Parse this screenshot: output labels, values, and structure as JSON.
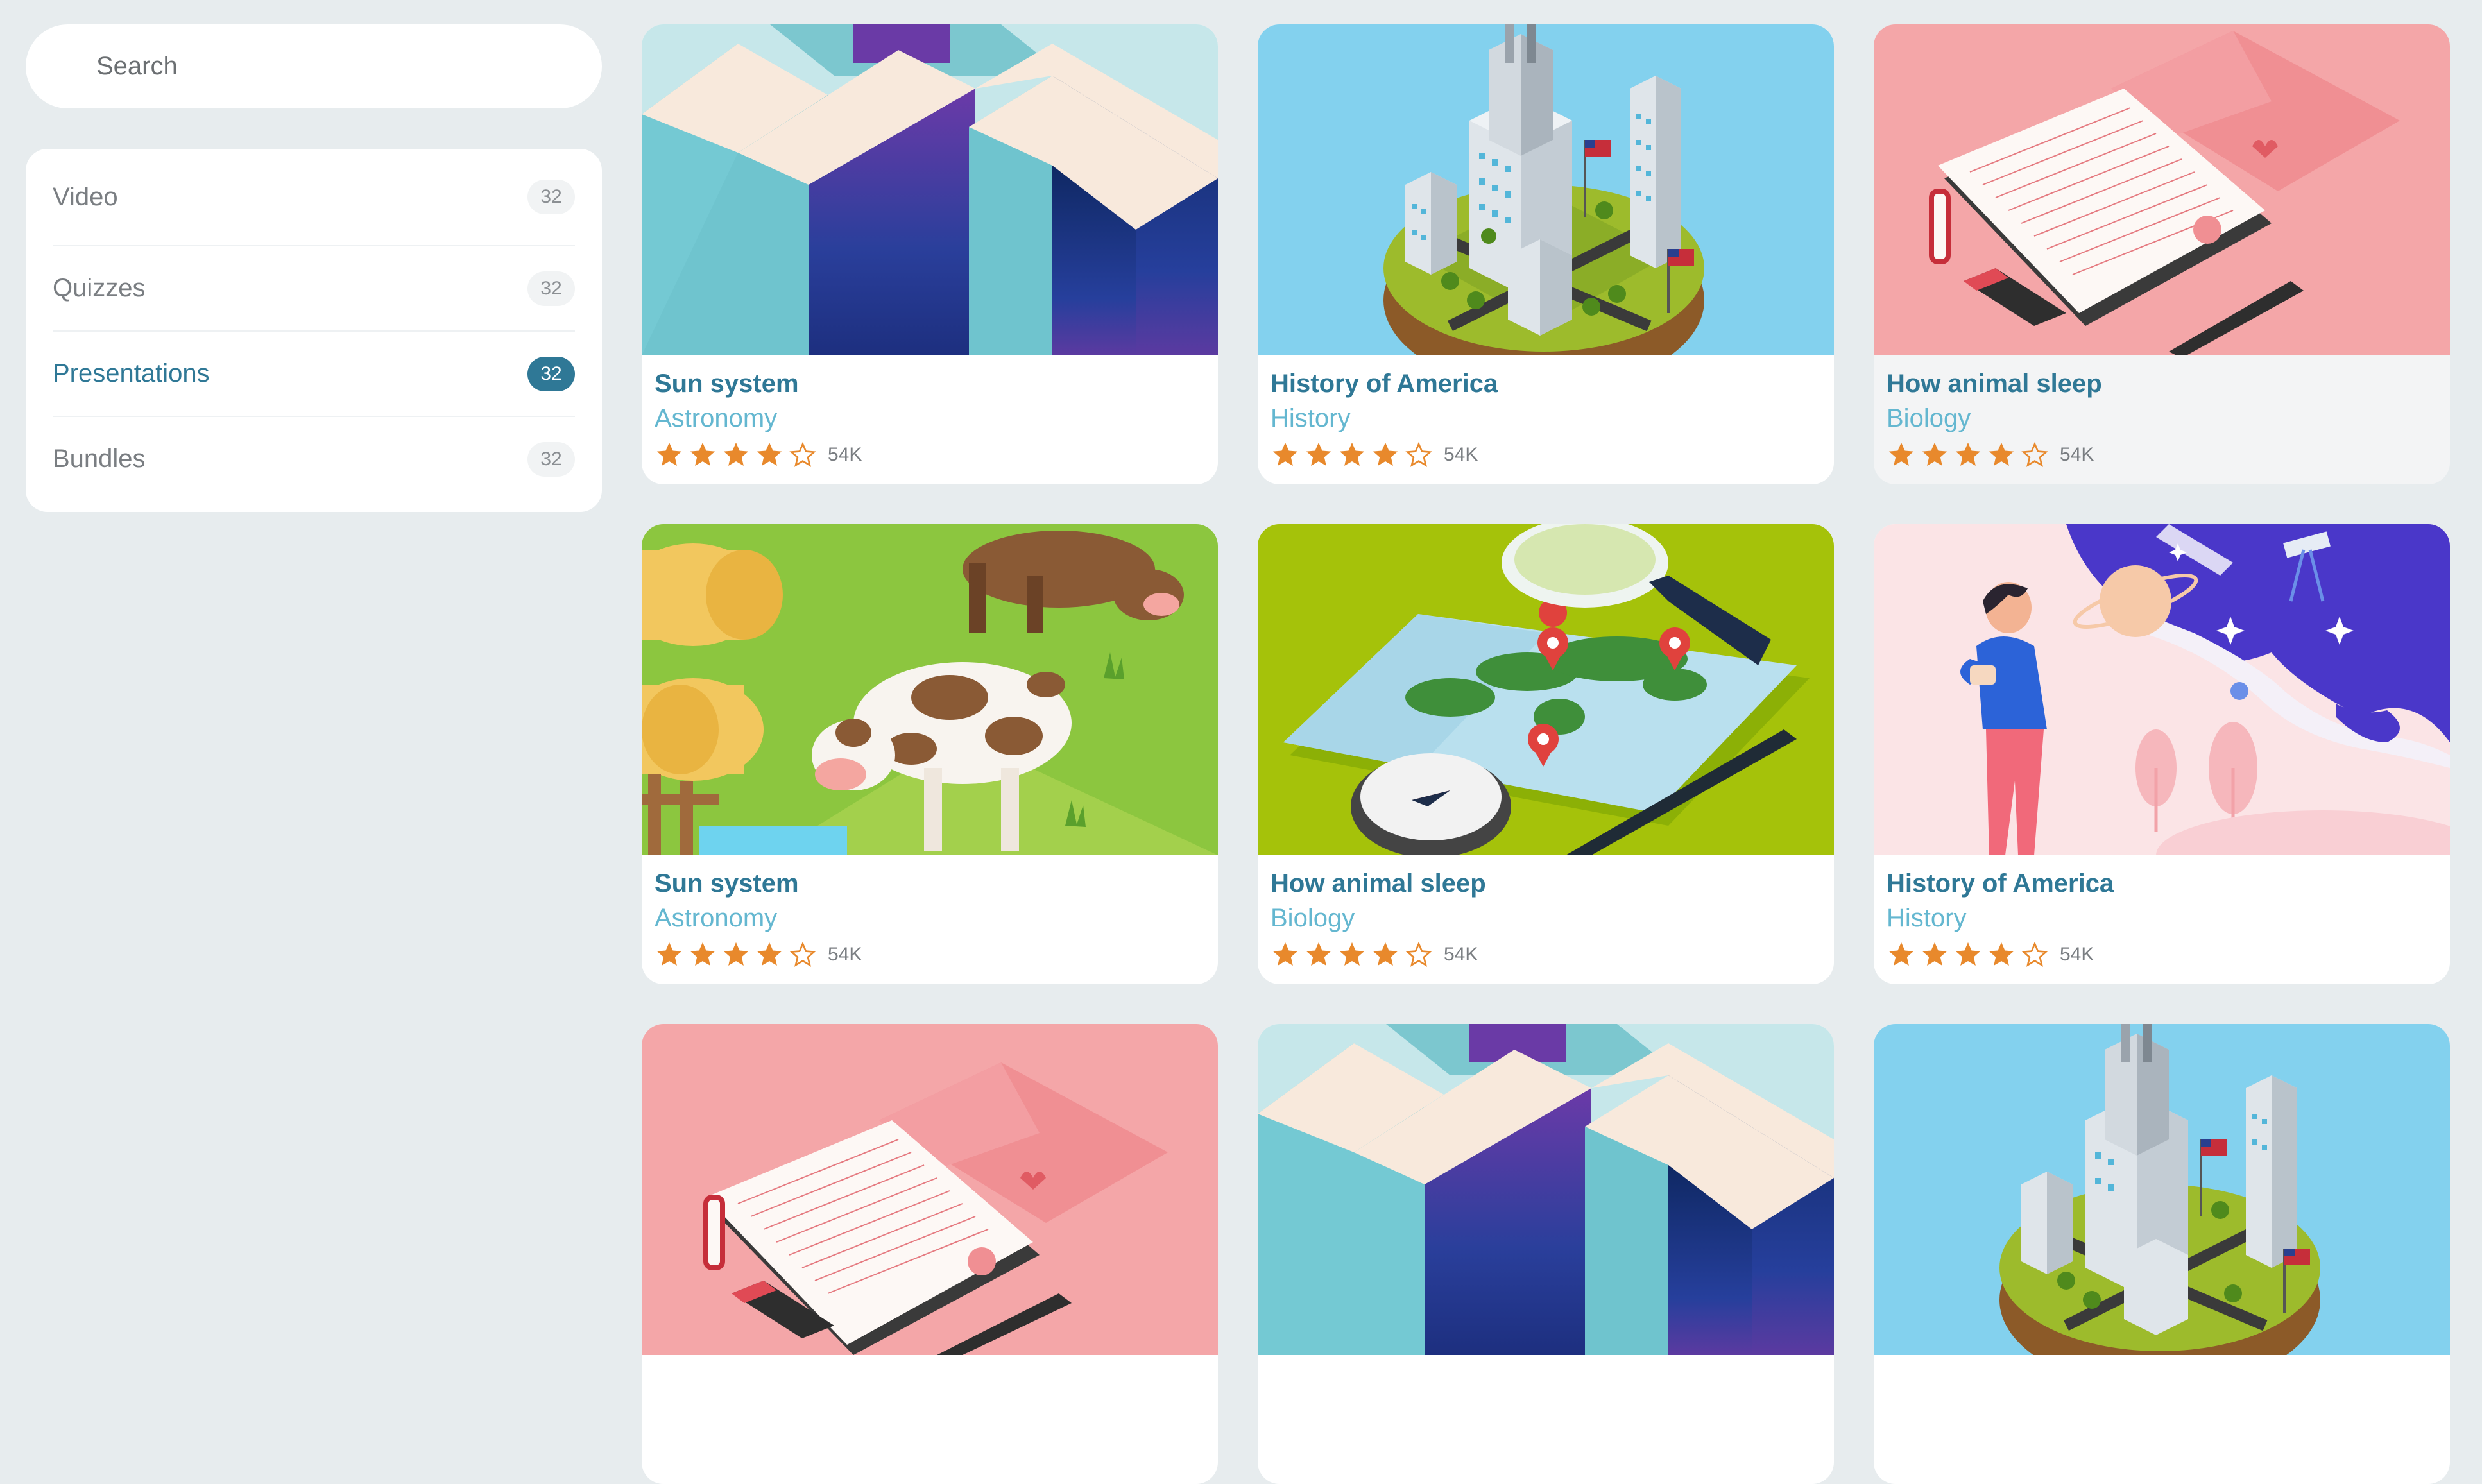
{
  "search": {
    "placeholder": "Search"
  },
  "menu": [
    {
      "label": "Video",
      "count": "32",
      "active": false
    },
    {
      "label": "Quizzes",
      "count": "32",
      "active": false
    },
    {
      "label": "Presentations",
      "count": "32",
      "active": true
    },
    {
      "label": "Bundles",
      "count": "32",
      "active": false
    }
  ],
  "colors": {
    "accent": "#2f7896",
    "subtitle": "#64b7d0",
    "star": "#e8892c",
    "background": "#e7ecee"
  },
  "cards": [
    {
      "title": "Sun system",
      "subtitle": "Astronomy",
      "rating": 4,
      "max_rating": 5,
      "count": "54K",
      "image": "isometric-blocks"
    },
    {
      "title": "History of America",
      "subtitle": "History",
      "rating": 4,
      "max_rating": 5,
      "count": "54K",
      "image": "isometric-city"
    },
    {
      "title": "How animal sleep",
      "subtitle": "Biology",
      "rating": 4,
      "max_rating": 5,
      "count": "54K",
      "image": "letter-envelope"
    },
    {
      "title": "Sun system",
      "subtitle": "Astronomy",
      "rating": 4,
      "max_rating": 5,
      "count": "54K",
      "image": "cows-farm"
    },
    {
      "title": "How animal sleep",
      "subtitle": "Biology",
      "rating": 4,
      "max_rating": 5,
      "count": "54K",
      "image": "world-map"
    },
    {
      "title": "History of America",
      "subtitle": "History",
      "rating": 4,
      "max_rating": 5,
      "count": "54K",
      "image": "person-space"
    },
    {
      "title": "",
      "subtitle": "",
      "rating": null,
      "max_rating": 5,
      "count": "",
      "image": "letter-envelope"
    },
    {
      "title": "",
      "subtitle": "",
      "rating": null,
      "max_rating": 5,
      "count": "",
      "image": "isometric-blocks"
    },
    {
      "title": "",
      "subtitle": "",
      "rating": null,
      "max_rating": 5,
      "count": "",
      "image": "isometric-city"
    }
  ]
}
